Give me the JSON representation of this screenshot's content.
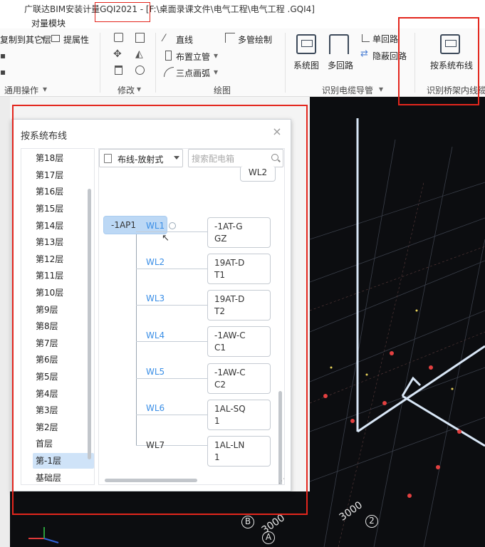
{
  "window": {
    "title": "广联达BIM安装计量GQI2021 - [F:\\桌面录课文件\\电气工程\\电气工程 .GQI4]"
  },
  "menu": {
    "module": "对量模块"
  },
  "ribbon": {
    "general_ops": {
      "copy_to_other_floor": "复制到其它层",
      "extract_props": "提属性",
      "group_label": "通用操作"
    },
    "modify": {
      "group_label": "修改"
    },
    "draw": {
      "straight_line": "直线",
      "multi_pipe_draw": "多管绘制",
      "place_riser": "布置立管",
      "three_point_arc": "三点画弧",
      "group_label": "绘图"
    },
    "identify_cable_conduit": {
      "system_diagram": "系统图",
      "multi_loop": "多回路",
      "single_loop": "单回路",
      "hidden_loop": "隐蔽回路",
      "group_label": "识别电缆导管"
    },
    "identify_tray_cable": {
      "by_system_route": "按系统布线",
      "group_label": "识别桥架内线缆"
    }
  },
  "dialog": {
    "title": "按系统布线",
    "close_symbol": "×",
    "mode_select": {
      "selected": "布线-放射式"
    },
    "search": {
      "placeholder": "搜索配电箱",
      "value": ""
    },
    "floors": [
      "第18层",
      "第17层",
      "第16层",
      "第15层",
      "第14层",
      "第13层",
      "第12层",
      "第11层",
      "第10层",
      "第9层",
      "第8层",
      "第7层",
      "第6层",
      "第5层",
      "第4层",
      "第3层",
      "第2层",
      "首层",
      "第-1层",
      "基础层"
    ],
    "selected_floor": "第-1层",
    "tree": {
      "top_partial_box": "WL2",
      "root": "-1AP1",
      "circuits": [
        {
          "circuit": "WL1",
          "dest_line1": "-1AT-G",
          "dest_line2": "GZ",
          "highlight": true
        },
        {
          "circuit": "WL2",
          "dest_line1": "19AT-D",
          "dest_line2": "T1",
          "highlight": true
        },
        {
          "circuit": "WL3",
          "dest_line1": "19AT-D",
          "dest_line2": "T2",
          "highlight": true
        },
        {
          "circuit": "WL4",
          "dest_line1": "-1AW-C",
          "dest_line2": "C1",
          "highlight": true
        },
        {
          "circuit": "WL5",
          "dest_line1": "-1AW-C",
          "dest_line2": "C2",
          "highlight": true
        },
        {
          "circuit": "WL6",
          "dest_line1": "1AL-SQ",
          "dest_line2": "1",
          "highlight": true
        },
        {
          "circuit": "WL7",
          "dest_line1": "1AL-LN",
          "dest_line2": "1",
          "highlight": false
        }
      ]
    }
  },
  "canvas": {
    "grid_label_b": "B",
    "grid_label_a": "A",
    "grid_label_2": "2",
    "dim_1": "3000",
    "dim_2": "3000"
  },
  "colors": {
    "highlight_red": "#e3261d",
    "link_blue": "#3a8ee6",
    "root_node_bg": "#bcd8f5",
    "selected_floor_bg": "#cfe3f8",
    "canvas_bg": "#0c0d10"
  }
}
